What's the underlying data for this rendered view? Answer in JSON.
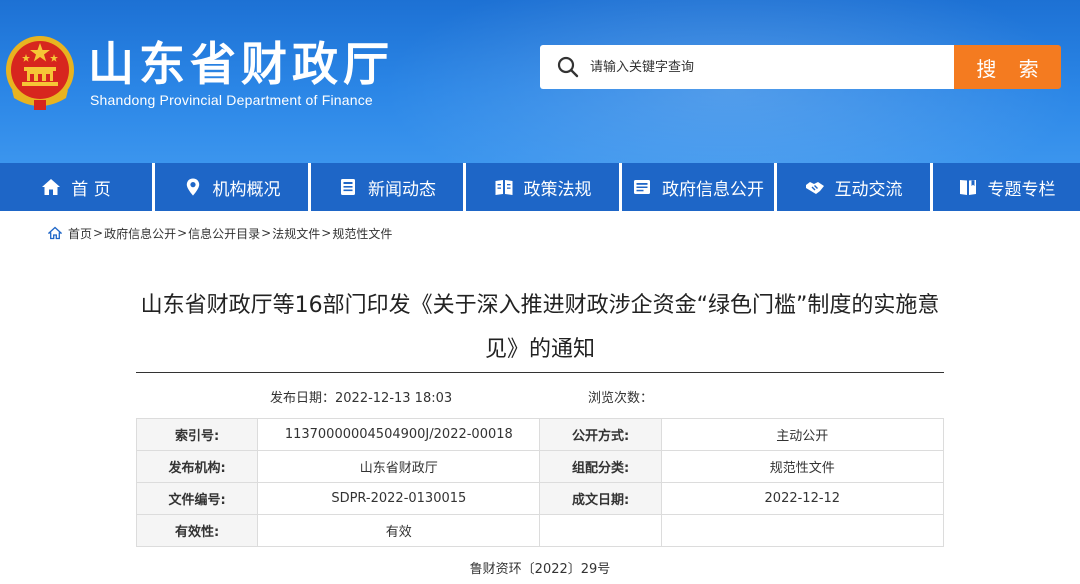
{
  "header": {
    "title": "山东省财政厅",
    "subtitle": "Shandong Provincial Department of Finance",
    "search_placeholder": "请输入关键字查询",
    "search_button": "搜 索",
    "colors": {
      "banner": "#2b86e6",
      "search_button": "#f47b20"
    }
  },
  "nav": {
    "items": [
      {
        "label": "首 页",
        "icon": "home-icon"
      },
      {
        "label": "机构概况",
        "icon": "location-pin-icon"
      },
      {
        "label": "新闻动态",
        "icon": "news-icon"
      },
      {
        "label": "政策法规",
        "icon": "book-icon"
      },
      {
        "label": "政府信息公开",
        "icon": "info-icon"
      },
      {
        "label": "互动交流",
        "icon": "handshake-icon"
      },
      {
        "label": "专题专栏",
        "icon": "bookmark-icon"
      }
    ],
    "color": "#1e66c7"
  },
  "breadcrumb": {
    "items": [
      "首页",
      "政府信息公开",
      "信息公开目录",
      "法规文件",
      "规范性文件"
    ],
    "separator": ">"
  },
  "article": {
    "title": "山东省财政厅等16部门印发《关于深入推进财政涉企资金“绿色门槛”制度的实施意见》的通知",
    "publish_date": "发布日期：2022-12-13 18:03",
    "views": "浏览次数：",
    "doc_number": "鲁财资环〔2022〕29号"
  },
  "info_table": {
    "rows": [
      {
        "k1": "索引号:",
        "v1": "11370000004504900J/2022-00018",
        "k2": "公开方式:",
        "v2": "主动公开"
      },
      {
        "k1": "发布机构:",
        "v1": "山东省财政厅",
        "k2": "组配分类:",
        "v2": "规范性文件"
      },
      {
        "k1": "文件编号:",
        "v1": "SDPR-2022-0130015",
        "k2": "成文日期:",
        "v2": "2022-12-12"
      },
      {
        "k1": "有效性:",
        "v1": "有效",
        "k2": "",
        "v2": ""
      }
    ]
  }
}
